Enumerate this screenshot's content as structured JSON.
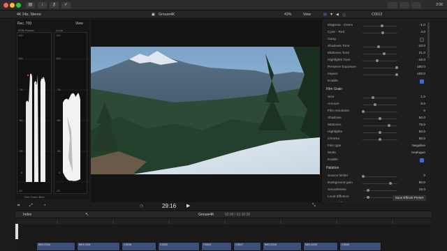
{
  "window": {
    "title": "Grouse4K",
    "clock": "2:06"
  },
  "subbar": {
    "format": "4K 24p, Stereo",
    "clip_name": "Grouse4K",
    "zoom": "43%",
    "view_menu": "View",
    "inspector_clip": "C0012"
  },
  "scopes": {
    "standard": "Rec. 709",
    "view_menu": "View",
    "parade_label": "RGB Parade",
    "luma_label": "Luma",
    "parade_ticks": [
      "120",
      "100",
      "75",
      "50",
      "25",
      "0",
      "-20"
    ],
    "luma_ticks": [
      "120",
      "100",
      "75",
      "50",
      "25",
      "0",
      "-20"
    ],
    "channel_legend": "Red Green Blue"
  },
  "transport": {
    "timecode": "29:16"
  },
  "timeline": {
    "index_label": "Index",
    "project": "Grouse4K",
    "duration": "02:00 / 01:10:20",
    "clips": [
      "IMG-0344",
      "IMG-0331",
      "C0016",
      "C0022",
      "C0023",
      "C0027",
      "IMG-0216",
      "IMG-0225",
      "C0042"
    ]
  },
  "inspector": {
    "rows_top": [
      {
        "label": "Magenta - Green",
        "value": "-1.0",
        "pos": 0.55
      },
      {
        "label": "Cyan - Red",
        "value": "4.0",
        "pos": 0.58
      }
    ],
    "gang_label": "Gang",
    "rows_tone": [
      {
        "label": "Shadows Tone",
        "value": "-10.0",
        "pos": 0.45
      },
      {
        "label": "Midtones Tone",
        "value": "21.0",
        "pos": 0.62
      },
      {
        "label": "Highlights Tone",
        "value": "-16.0",
        "pos": 0.42
      },
      {
        "label": "Preserve Exposure",
        "value": "100.0",
        "pos": 0.98
      },
      {
        "label": "Impact",
        "value": "100.0",
        "pos": 0.98
      }
    ],
    "enable_label": "Enable",
    "film_grain": {
      "header": "Film Grain",
      "rows": [
        {
          "label": "Size",
          "value": "1.0",
          "pos": 0.3
        },
        {
          "label": "Amount",
          "value": "8.0",
          "pos": 0.35
        },
        {
          "label": "Film resolution",
          "value": "0",
          "pos": 0.02
        },
        {
          "label": "Shadows",
          "value": "50.0",
          "pos": 0.5
        },
        {
          "label": "Midtones",
          "value": "75.0",
          "pos": 0.75
        },
        {
          "label": "Highlights",
          "value": "50.0",
          "pos": 0.5
        },
        {
          "label": "Chroma",
          "value": "50.0",
          "pos": 0.5
        }
      ],
      "film_type_label": "Film type",
      "film_type_value": "Negative",
      "mode_label": "Mode",
      "mode_value": "Analogue",
      "enable_label": "Enable"
    },
    "halation": {
      "header": "Halation",
      "rows": [
        {
          "label": "Source limiter",
          "value": "0",
          "pos": 0.02
        },
        {
          "label": "Background gain",
          "value": "80.0",
          "pos": 0.8
        },
        {
          "label": "Smoothness",
          "value": "15.0",
          "pos": 0.15
        },
        {
          "label": "Local diffusion",
          "value": "15.0",
          "pos": 0.15
        },
        {
          "label": "Global diffusion",
          "value": "15.0",
          "pos": 0.15
        }
      ]
    },
    "save_preset": "Save Effects Preset"
  }
}
